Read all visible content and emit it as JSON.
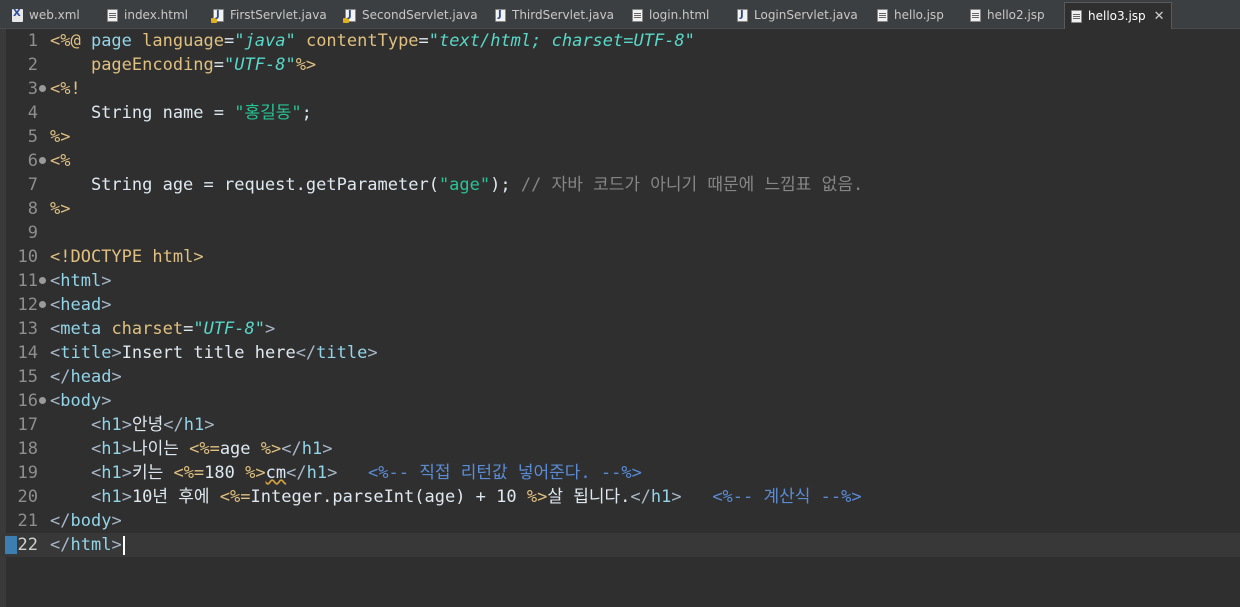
{
  "tabs": [
    {
      "label": "web.xml",
      "icon": "xml-file-icon"
    },
    {
      "label": "index.html",
      "icon": "html-file-icon"
    },
    {
      "label": "FirstServlet.java",
      "icon": "servlet-file-icon"
    },
    {
      "label": "SecondServlet.java",
      "icon": "servlet-file-icon"
    },
    {
      "label": "ThirdServlet.java",
      "icon": "java-file-icon"
    },
    {
      "label": "login.html",
      "icon": "html-file-icon"
    },
    {
      "label": "LoginServlet.java",
      "icon": "java-file-icon"
    },
    {
      "label": "hello.jsp",
      "icon": "jsp-file-icon"
    },
    {
      "label": "hello2.jsp",
      "icon": "jsp-file-icon"
    },
    {
      "label": "hello3.jsp",
      "icon": "jsp-file-icon",
      "active": true
    }
  ],
  "close_glyph": "✕",
  "editor": {
    "current_line": 22,
    "lines": [
      {
        "n": "1",
        "fold": false,
        "tokens": [
          [
            "jsp",
            "<%@ "
          ],
          [
            "kw",
            "page "
          ],
          [
            "attr",
            "language"
          ],
          [
            "plain",
            "="
          ],
          [
            "str",
            "\"java\""
          ],
          [
            "plain",
            " "
          ],
          [
            "attr",
            "contentType"
          ],
          [
            "plain",
            "="
          ],
          [
            "str",
            "\"text/html; charset=UTF-8\""
          ]
        ]
      },
      {
        "n": "2",
        "fold": false,
        "tokens": [
          [
            "plain",
            "    "
          ],
          [
            "attr",
            "pageEncoding"
          ],
          [
            "plain",
            "="
          ],
          [
            "str",
            "\"UTF-8\""
          ],
          [
            "jsp",
            "%>"
          ]
        ]
      },
      {
        "n": "3",
        "fold": true,
        "tokens": [
          [
            "jsp",
            "<%!"
          ]
        ]
      },
      {
        "n": "4",
        "fold": false,
        "tokens": [
          [
            "plain",
            "    String name = "
          ],
          [
            "jstr",
            "\"홍길동\""
          ],
          [
            "plain",
            ";"
          ]
        ]
      },
      {
        "n": "5",
        "fold": false,
        "tokens": [
          [
            "jsp",
            "%>"
          ]
        ]
      },
      {
        "n": "6",
        "fold": true,
        "tokens": [
          [
            "jsp",
            "<%"
          ]
        ]
      },
      {
        "n": "7",
        "fold": false,
        "tokens": [
          [
            "plain",
            "    String age = request.getParameter("
          ],
          [
            "jstr",
            "\"age\""
          ],
          [
            "plain",
            "); "
          ],
          [
            "cmt",
            "// 자바 코드가 아니기 때문에 느낌표 없음."
          ]
        ]
      },
      {
        "n": "8",
        "fold": false,
        "tokens": [
          [
            "jsp",
            "%>"
          ]
        ]
      },
      {
        "n": "9",
        "fold": false,
        "tokens": []
      },
      {
        "n": "10",
        "fold": false,
        "tokens": [
          [
            "doc",
            "<!DOCTYPE "
          ],
          [
            "attr",
            "html"
          ],
          [
            "doc",
            ">"
          ]
        ]
      },
      {
        "n": "11",
        "fold": true,
        "tokens": [
          [
            "brk",
            "<"
          ],
          [
            "tag",
            "html"
          ],
          [
            "brk",
            ">"
          ]
        ]
      },
      {
        "n": "12",
        "fold": true,
        "tokens": [
          [
            "brk",
            "<"
          ],
          [
            "tag",
            "head"
          ],
          [
            "brk",
            ">"
          ]
        ]
      },
      {
        "n": "13",
        "fold": false,
        "tokens": [
          [
            "brk",
            "<"
          ],
          [
            "tag",
            "meta "
          ],
          [
            "attr",
            "charset"
          ],
          [
            "plain",
            "="
          ],
          [
            "str",
            "\"UTF-8\""
          ],
          [
            "brk",
            ">"
          ]
        ]
      },
      {
        "n": "14",
        "fold": false,
        "tokens": [
          [
            "brk",
            "<"
          ],
          [
            "tag",
            "title"
          ],
          [
            "brk",
            ">"
          ],
          [
            "txt",
            "Insert title here"
          ],
          [
            "brk",
            "</"
          ],
          [
            "tag",
            "title"
          ],
          [
            "brk",
            ">"
          ]
        ]
      },
      {
        "n": "15",
        "fold": false,
        "tokens": [
          [
            "brk",
            "</"
          ],
          [
            "tag",
            "head"
          ],
          [
            "brk",
            ">"
          ]
        ]
      },
      {
        "n": "16",
        "fold": true,
        "tokens": [
          [
            "brk",
            "<"
          ],
          [
            "tag",
            "body"
          ],
          [
            "brk",
            ">"
          ]
        ]
      },
      {
        "n": "17",
        "fold": false,
        "tokens": [
          [
            "plain",
            "    "
          ],
          [
            "brk",
            "<"
          ],
          [
            "tag",
            "h1"
          ],
          [
            "brk",
            ">"
          ],
          [
            "txt",
            "안녕"
          ],
          [
            "brk",
            "</"
          ],
          [
            "tag",
            "h1"
          ],
          [
            "brk",
            ">"
          ]
        ]
      },
      {
        "n": "18",
        "fold": false,
        "tokens": [
          [
            "plain",
            "    "
          ],
          [
            "brk",
            "<"
          ],
          [
            "tag",
            "h1"
          ],
          [
            "brk",
            ">"
          ],
          [
            "txt",
            "나이는 "
          ],
          [
            "jsp",
            "<%="
          ],
          [
            "plain",
            "age "
          ],
          [
            "jsp",
            "%>"
          ],
          [
            "brk",
            "</"
          ],
          [
            "tag",
            "h1"
          ],
          [
            "brk",
            ">"
          ]
        ]
      },
      {
        "n": "19",
        "fold": false,
        "tokens": [
          [
            "plain",
            "    "
          ],
          [
            "brk",
            "<"
          ],
          [
            "tag",
            "h1"
          ],
          [
            "brk",
            ">"
          ],
          [
            "txt",
            "키는 "
          ],
          [
            "jsp",
            "<%="
          ],
          [
            "plain",
            "180 "
          ],
          [
            "jsp",
            "%>"
          ],
          [
            "squig",
            "cm"
          ],
          [
            "brk",
            "</"
          ],
          [
            "tag",
            "h1"
          ],
          [
            "brk",
            ">"
          ],
          [
            "plain",
            "   "
          ],
          [
            "jcmt",
            "<%-- 직접 리턴값 넣어준다. --%>"
          ]
        ]
      },
      {
        "n": "20",
        "fold": false,
        "tokens": [
          [
            "plain",
            "    "
          ],
          [
            "brk",
            "<"
          ],
          [
            "tag",
            "h1"
          ],
          [
            "brk",
            ">"
          ],
          [
            "txt",
            "10년 후에 "
          ],
          [
            "jsp",
            "<%="
          ],
          [
            "plain",
            "Integer.parseInt(age) + 10 "
          ],
          [
            "jsp",
            "%>"
          ],
          [
            "txt",
            "살 됩니다."
          ],
          [
            "brk",
            "</"
          ],
          [
            "tag",
            "h1"
          ],
          [
            "brk",
            ">"
          ],
          [
            "plain",
            "   "
          ],
          [
            "jcmt",
            "<%-- 계산식 --%>"
          ]
        ]
      },
      {
        "n": "21",
        "fold": false,
        "tokens": [
          [
            "brk",
            "</"
          ],
          [
            "tag",
            "body"
          ],
          [
            "brk",
            ">"
          ]
        ]
      },
      {
        "n": "22",
        "fold": false,
        "tokens": [
          [
            "brk",
            "</"
          ],
          [
            "tag",
            "html"
          ],
          [
            "brk",
            ">"
          ]
        ]
      }
    ]
  }
}
